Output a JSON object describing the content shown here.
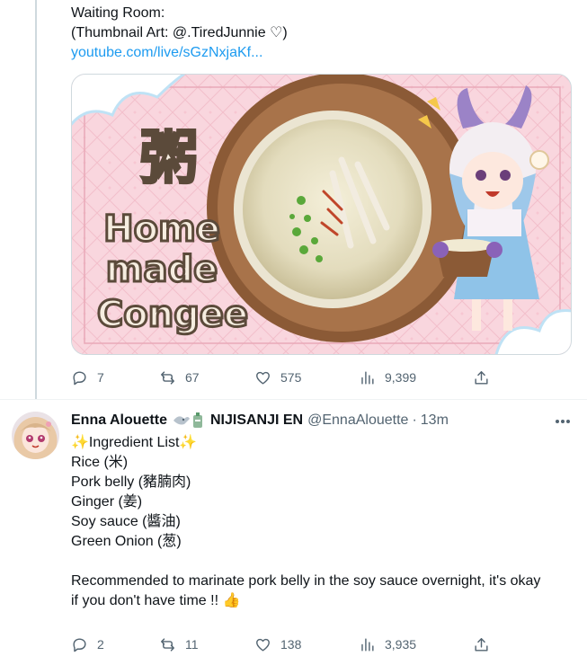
{
  "tweet1": {
    "lines": [
      "Waiting Room:",
      "(Thumbnail Art: @.TiredJunnie ♡)"
    ],
    "link": "youtube.com/live/sGzNxjaKf...",
    "thumbnail": {
      "kanji": "粥",
      "words": [
        "Home",
        "made",
        "Congee"
      ]
    },
    "actions": {
      "replies": "7",
      "retweets": "67",
      "likes": "575",
      "views": "9,399"
    }
  },
  "tweet2": {
    "name": "Enna Alouette",
    "affiliation": "NIJISANJI EN",
    "handle": "@EnnaAlouette",
    "separator": "·",
    "time": "13m",
    "lines": [
      "✨Ingredient List✨",
      "Rice (米)",
      "Pork belly (豬腩肉)",
      "Ginger (姜)",
      "Soy sauce (醬油)",
      "Green Onion (葱)"
    ],
    "paragraph": [
      "Recommended to marinate pork belly in the soy sauce overnight, it's okay",
      "if you don't have time !! 👍"
    ],
    "actions": {
      "replies": "2",
      "retweets": "11",
      "likes": "138",
      "views": "3,935"
    }
  },
  "colors": {
    "link": "#1d9bf0",
    "muted": "#536471",
    "text": "#0f1419",
    "divider": "#eff3f4"
  }
}
